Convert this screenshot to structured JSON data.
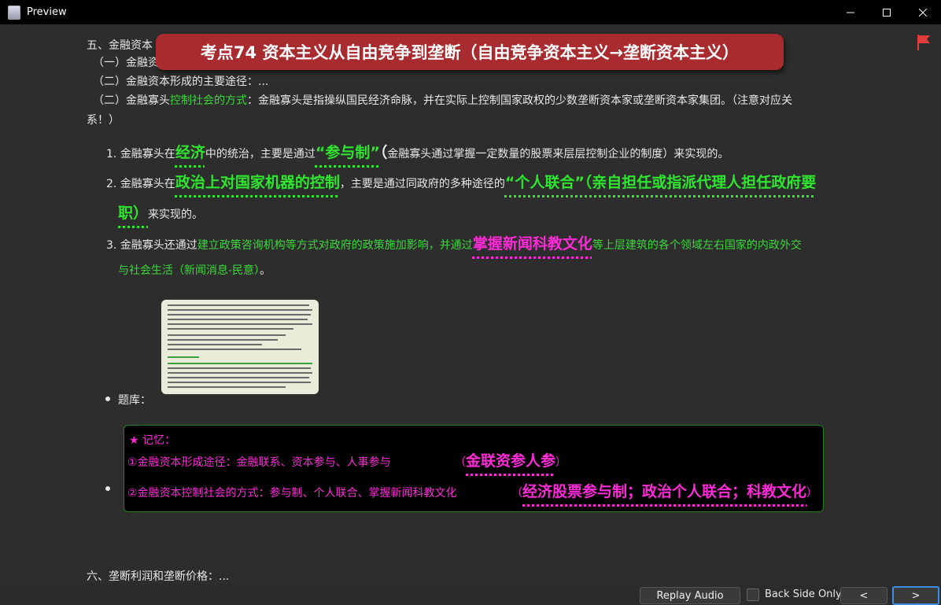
{
  "window": {
    "title": "Preview"
  },
  "banner": {
    "text": "考点74 资本主义从自由竞争到垄断（自由竞争资本主义→垄断资本主义）"
  },
  "section5": {
    "heading": "五、金融资本",
    "sub1": "（一）金融资",
    "sub2": "（二）金融资本形成的主要途径：...",
    "sub3_prefix": "（二）金融寡头",
    "sub3_green": "控制社会的方式",
    "sub3_rest": "：金融寡头是指操纵国民经济命脉，并在实际上控制国家政权的少数垄断资本家或垄断资本家集团。（注意对应关",
    "sub3_cont": "系！）"
  },
  "items": [
    {
      "num": "1.",
      "a": "金融寡头在",
      "b": "经济",
      "c": "中的统治，主要是通过",
      "d": "“参与制”",
      "e": "（",
      "f": "金融寡头通过掌握一定数量的股票来层层控制企业的制度）来实现的。"
    },
    {
      "num": "2.",
      "a": "金融寡头在",
      "b": "政治上对国家机器的控制",
      "c": "，主要是通过同政府的多种途径的",
      "d": "“个人联合”（亲自担任或指派代理人担任政府要",
      "e": "职）",
      "f": "来实现的。"
    },
    {
      "num": "3.",
      "a": "金融寡头还通过",
      "b": "建立政策咨询机构等方式对政府的政策施加影响，并通过",
      "c": "掌握新闻科教文化",
      "d": "等上层建筑的各个领域左右国家的内政外交",
      "e": "与社会生活（新闻消息-民意）",
      "f": "。"
    }
  ],
  "tiku_label": "题库：",
  "memo": {
    "title": "★ 记忆：",
    "line1": "①金融资本形成途径：金融联系、资本参与、人事参与",
    "line1_open": "（",
    "line1_bold": "金联资参人参",
    "line1_close": "）",
    "line2": "②金融资本控制社会的方式：参与制、个人联合、掌握新闻科教文化",
    "line2_open": "（",
    "line2_bold": "经济股票参与制；政治个人联合；科教文化",
    "line2_close": "）"
  },
  "section6": {
    "heading": "六、垄断利润和垄断价格：..."
  },
  "controls": {
    "replay": "Replay Audio",
    "back_side_only": "Back Side Only",
    "prev": "<",
    "next": ">"
  }
}
